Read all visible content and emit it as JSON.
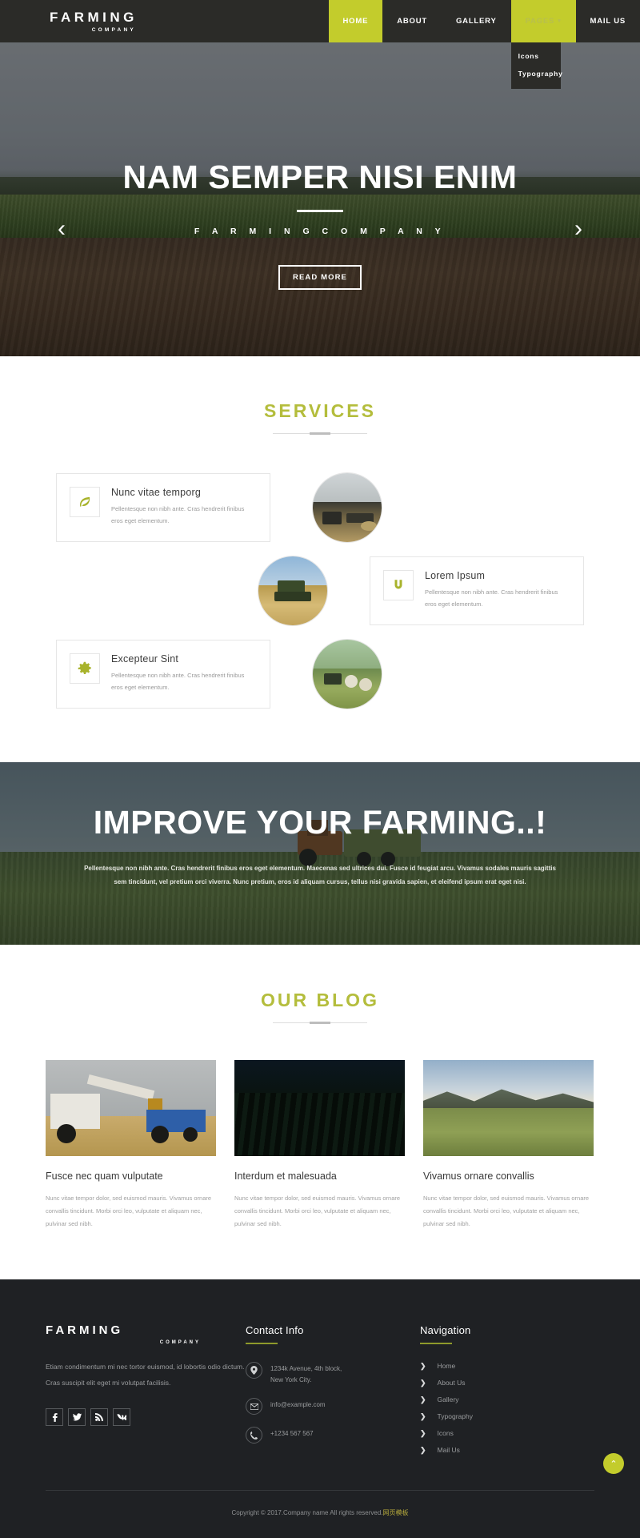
{
  "colors": {
    "accent": "#c3cc2c",
    "accent_title": "#b4bd3c",
    "dark_header": "#2b2b28",
    "footer_bg": "#1f2124"
  },
  "header": {
    "brand_name": "FARMING",
    "brand_sub": "COMPANY",
    "nav": [
      {
        "label": "HOME",
        "state": "active"
      },
      {
        "label": "ABOUT",
        "state": "normal"
      },
      {
        "label": "GALLERY",
        "state": "normal"
      },
      {
        "label": "PAGES",
        "state": "open",
        "caret": "▾"
      },
      {
        "label": "MAIL US",
        "state": "normal"
      }
    ],
    "dropdown": [
      {
        "label": "Icons"
      },
      {
        "label": "Typography"
      }
    ]
  },
  "hero": {
    "title": "NAM SEMPER NISI ENIM",
    "subtitle": "F A R M I N G   C O M P A N Y",
    "button": "READ MORE",
    "prev_arrow": "‹",
    "next_arrow": "›"
  },
  "services": {
    "title": "SERVICES",
    "cards": [
      {
        "icon": "leaf-icon",
        "title": "Nunc vitae temporg",
        "text": "Pellentesque non nibh ante. Cras hendrerit finibus eros eget elementum."
      },
      {
        "icon": "magnet-icon",
        "title": "Lorem Ipsum",
        "text": "Pellentesque non nibh ante. Cras hendrerit finibus eros eget elementum."
      },
      {
        "icon": "gear-icon",
        "title": "Excepteur Sint",
        "text": "Pellentesque non nibh ante. Cras hendrerit finibus eros eget elementum."
      }
    ]
  },
  "banner": {
    "title": "IMPROVE YOUR FARMING..!",
    "text": "Pellentesque non nibh ante. Cras hendrerit finibus eros eget elementum. Maecenas sed ultrices dui. Fusce id feugiat arcu. Vivamus sodales mauris sagittis sem tincidunt, vel pretium orci viverra. Nunc pretium, eros id aliquam cursus, tellus nisi gravida sapien, et eleifend ipsum erat eget nisi."
  },
  "blog": {
    "title": "OUR BLOG",
    "posts": [
      {
        "title": "Fusce nec quam vulputate",
        "text": "Nunc vitae tempor dolor, sed euismod mauris. Vivamus ornare convallis tincidunt. Morbi orci leo, vulputate et aliquam nec, pulvinar sed nibh."
      },
      {
        "title": "Interdum et malesuada",
        "text": "Nunc vitae tempor dolor, sed euismod mauris. Vivamus ornare convallis tincidunt. Morbi orci leo, vulputate et aliquam nec, pulvinar sed nibh."
      },
      {
        "title": "Vivamus ornare convallis",
        "text": "Nunc vitae tempor dolor, sed euismod mauris. Vivamus ornare convallis tincidunt. Morbi orci leo, vulputate et aliquam nec, pulvinar sed nibh."
      }
    ]
  },
  "footer": {
    "brand_name": "FARMING",
    "brand_sub": "COMPANY",
    "about_text": "Etiam condimentum mi nec tortor euismod, id lobortis odio dictum. Cras suscipit elit eget mi volutpat facilisis.",
    "social": [
      {
        "name": "facebook-icon",
        "glyph": "f"
      },
      {
        "name": "twitter-icon",
        "glyph": "🐦"
      },
      {
        "name": "rss-icon",
        "glyph": "◠"
      },
      {
        "name": "vk-icon",
        "glyph": "vk"
      }
    ],
    "contact": {
      "title": "Contact Info",
      "items": [
        {
          "icon": "location-pin-icon",
          "line1": "1234k Avenue, 4th block,",
          "line2": "New York City."
        },
        {
          "icon": "envelope-icon",
          "line1": "info@example.com",
          "line2": ""
        },
        {
          "icon": "phone-icon",
          "line1": "+1234 567 567",
          "line2": ""
        }
      ]
    },
    "navigation": {
      "title": "Navigation",
      "links": [
        {
          "label": "Home"
        },
        {
          "label": "About Us"
        },
        {
          "label": "Gallery"
        },
        {
          "label": "Typography"
        },
        {
          "label": "Icons"
        },
        {
          "label": "Mail Us"
        }
      ]
    },
    "copyright_text": "Copyright © 2017.Company name All rights reserved.",
    "copyright_cn": "网页模板"
  },
  "to_top": {
    "glyph": "⌃"
  }
}
